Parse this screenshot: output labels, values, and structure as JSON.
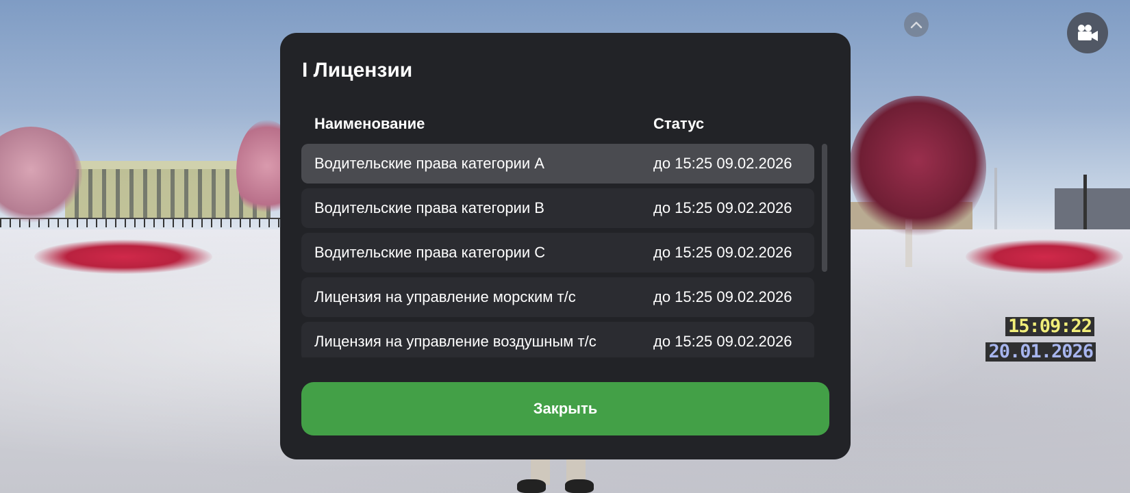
{
  "modal": {
    "title": "I Лицензии",
    "columns": {
      "name": "Наименование",
      "status": "Статус"
    },
    "rows": [
      {
        "name": "Водительские права категории A",
        "status": "до 15:25 09.02.2026",
        "selected": true
      },
      {
        "name": "Водительские права категории B",
        "status": "до 15:25 09.02.2026",
        "selected": false
      },
      {
        "name": "Водительские права категории C",
        "status": "до 15:25 09.02.2026",
        "selected": false
      },
      {
        "name": "Лицензия на управление морским т/с",
        "status": "до 15:25 09.02.2026",
        "selected": false
      },
      {
        "name": "Лицензия на управление воздушным т/с",
        "status": "до 15:25 09.02.2026",
        "selected": false
      }
    ],
    "close_label": "Закрыть"
  },
  "hud": {
    "time": "15:09:22",
    "date": "20.01.2026",
    "up_icon": "chevron-up-icon",
    "camera_icon": "video-camera-icon"
  },
  "colors": {
    "modal_bg": "#222327",
    "row_bg": "#2b2c31",
    "row_selected_bg": "#4a4b50",
    "close_button": "#43a047",
    "clock_time": "#f1ee7a",
    "clock_date": "#a8b6ef"
  }
}
